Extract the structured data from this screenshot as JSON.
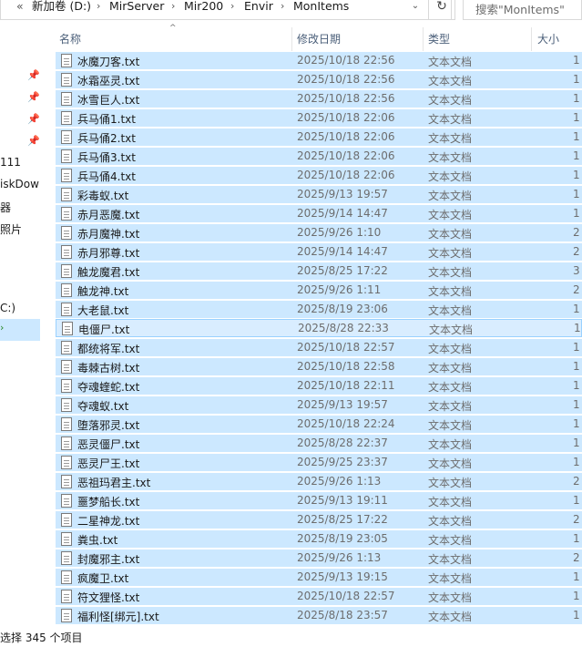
{
  "addressbar": {
    "back_chevrons": "«",
    "crumbs": [
      "新加卷 (D:)",
      "MirServer",
      "Mir200",
      "Envir",
      "MonItems"
    ],
    "separator": "›",
    "dropdown": "⌄",
    "refresh": "↻"
  },
  "search": {
    "placeholder": "搜索\"MonItems\""
  },
  "nav": {
    "items": [
      "111",
      "iskDow",
      "器",
      "照片",
      "C:)"
    ],
    "selected_marker": "›"
  },
  "columns": {
    "name": "名称",
    "date": "修改日期",
    "type": "类型",
    "size": "大小"
  },
  "files": [
    {
      "name": "冰魔刀客.txt",
      "date": "2025/10/18 22:56",
      "type": "文本文档",
      "size": "1"
    },
    {
      "name": "冰霜巫灵.txt",
      "date": "2025/10/18 22:56",
      "type": "文本文档",
      "size": "1"
    },
    {
      "name": "冰雪巨人.txt",
      "date": "2025/10/18 22:56",
      "type": "文本文档",
      "size": "1"
    },
    {
      "name": "兵马俑1.txt",
      "date": "2025/10/18 22:06",
      "type": "文本文档",
      "size": "1"
    },
    {
      "name": "兵马俑2.txt",
      "date": "2025/10/18 22:06",
      "type": "文本文档",
      "size": "1"
    },
    {
      "name": "兵马俑3.txt",
      "date": "2025/10/18 22:06",
      "type": "文本文档",
      "size": "1"
    },
    {
      "name": "兵马俑4.txt",
      "date": "2025/10/18 22:06",
      "type": "文本文档",
      "size": "1"
    },
    {
      "name": "彩毒蚁.txt",
      "date": "2025/9/13 19:57",
      "type": "文本文档",
      "size": "1"
    },
    {
      "name": "赤月恶魔.txt",
      "date": "2025/9/14 14:47",
      "type": "文本文档",
      "size": "1"
    },
    {
      "name": "赤月魔神.txt",
      "date": "2025/9/26 1:10",
      "type": "文本文档",
      "size": "2"
    },
    {
      "name": "赤月邪尊.txt",
      "date": "2025/9/14 14:47",
      "type": "文本文档",
      "size": "2"
    },
    {
      "name": "触龙魔君.txt",
      "date": "2025/8/25 17:22",
      "type": "文本文档",
      "size": "3"
    },
    {
      "name": "触龙神.txt",
      "date": "2025/9/26 1:11",
      "type": "文本文档",
      "size": "2"
    },
    {
      "name": "大老鼠.txt",
      "date": "2025/8/19 23:06",
      "type": "文本文档",
      "size": "1"
    },
    {
      "name": "电僵尸.txt",
      "date": "2025/8/28 22:33",
      "type": "文本文档",
      "size": "1"
    },
    {
      "name": "都统将军.txt",
      "date": "2025/10/18 22:57",
      "type": "文本文档",
      "size": "1"
    },
    {
      "name": "毒棘古树.txt",
      "date": "2025/10/18 22:58",
      "type": "文本文档",
      "size": "1"
    },
    {
      "name": "夺魂蝰蛇.txt",
      "date": "2025/10/18 22:11",
      "type": "文本文档",
      "size": "1"
    },
    {
      "name": "夺魂蚁.txt",
      "date": "2025/9/13 19:57",
      "type": "文本文档",
      "size": "1"
    },
    {
      "name": "堕落邪灵.txt",
      "date": "2025/10/18 22:24",
      "type": "文本文档",
      "size": "1"
    },
    {
      "name": "恶灵僵尸.txt",
      "date": "2025/8/28 22:37",
      "type": "文本文档",
      "size": "1"
    },
    {
      "name": "恶灵尸王.txt",
      "date": "2025/9/25 23:37",
      "type": "文本文档",
      "size": "1"
    },
    {
      "name": "恶祖玛君主.txt",
      "date": "2025/9/26 1:13",
      "type": "文本文档",
      "size": "2"
    },
    {
      "name": "噩梦船长.txt",
      "date": "2025/9/13 19:11",
      "type": "文本文档",
      "size": "1"
    },
    {
      "name": "二星神龙.txt",
      "date": "2025/8/25 17:22",
      "type": "文本文档",
      "size": "2"
    },
    {
      "name": "粪虫.txt",
      "date": "2025/8/19 23:05",
      "type": "文本文档",
      "size": "1"
    },
    {
      "name": "封魔邪主.txt",
      "date": "2025/9/26 1:13",
      "type": "文本文档",
      "size": "2"
    },
    {
      "name": "疯魔卫.txt",
      "date": "2025/9/13 19:15",
      "type": "文本文档",
      "size": "1"
    },
    {
      "name": "符文狸怪.txt",
      "date": "2025/10/18 22:57",
      "type": "文本文档",
      "size": "1"
    },
    {
      "name": "福利怪[绑元].txt",
      "date": "2025/8/18 23:57",
      "type": "文本文档",
      "size": "1"
    }
  ],
  "status": {
    "text": "选择 345 个项目"
  },
  "colors": {
    "selection": "#cce8ff",
    "focus_border": "#99d1ff",
    "header_text": "#4c607a"
  }
}
